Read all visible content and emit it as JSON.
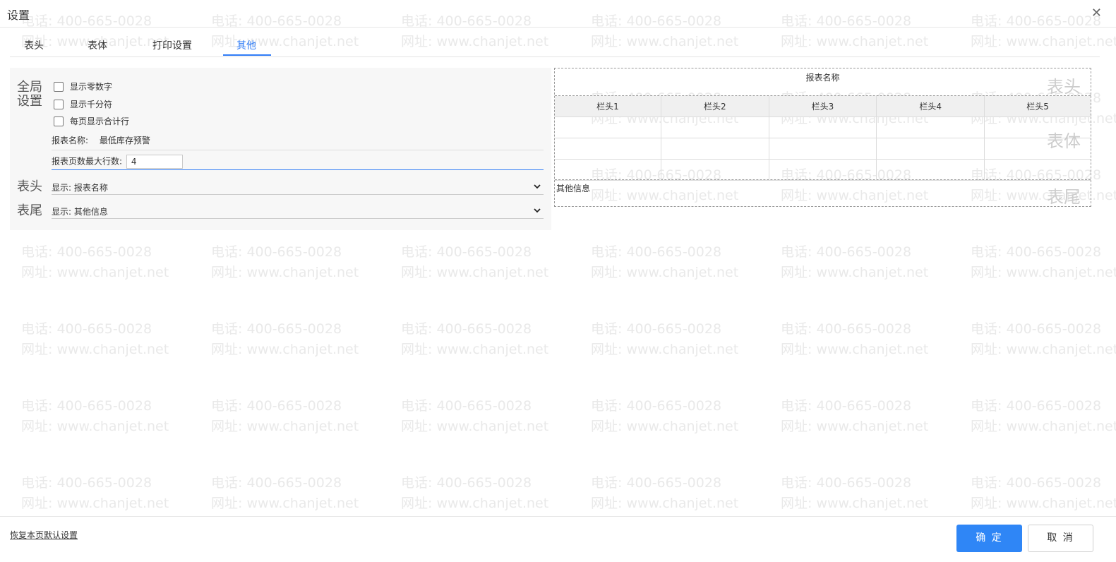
{
  "dialog": {
    "title": "设置"
  },
  "tabs": [
    {
      "label": "表头"
    },
    {
      "label": "表体"
    },
    {
      "label": "打印设置"
    },
    {
      "label": "其他",
      "active": true
    }
  ],
  "global": {
    "label": "全局\n设置",
    "checkboxes": [
      {
        "label": "显示零数字",
        "checked": false
      },
      {
        "label": "显示千分符",
        "checked": false
      },
      {
        "label": "每页显示合计行",
        "checked": false
      }
    ],
    "report_name_label": "报表名称:",
    "report_name_value": "最低库存预警",
    "max_rows_label": "报表页数最大行数:",
    "max_rows_value": "4"
  },
  "header_section": {
    "label": "表头",
    "select_text": "显示:  报表名称"
  },
  "footer_section": {
    "label": "表尾",
    "select_text": "显示:  其他信息"
  },
  "preview": {
    "report_name": "报表名称",
    "area_header": "表头",
    "area_body": "表体",
    "area_footer": "表尾",
    "columns": [
      "栏头1",
      "栏头2",
      "栏头3",
      "栏头4",
      "栏头5"
    ],
    "footer_text": "其他信息"
  },
  "footer_bar": {
    "restore_label": "恢复本页默认设置",
    "ok_label": "确 定",
    "cancel_label": "取 消"
  },
  "watermark": {
    "line1": "电话: 400-665-0028",
    "line2": "网址: www.chanjet.net"
  },
  "colors": {
    "accent": "#2f7cf6",
    "primary_button": "#2f86f6",
    "panel_bg": "#f7f7f7"
  }
}
